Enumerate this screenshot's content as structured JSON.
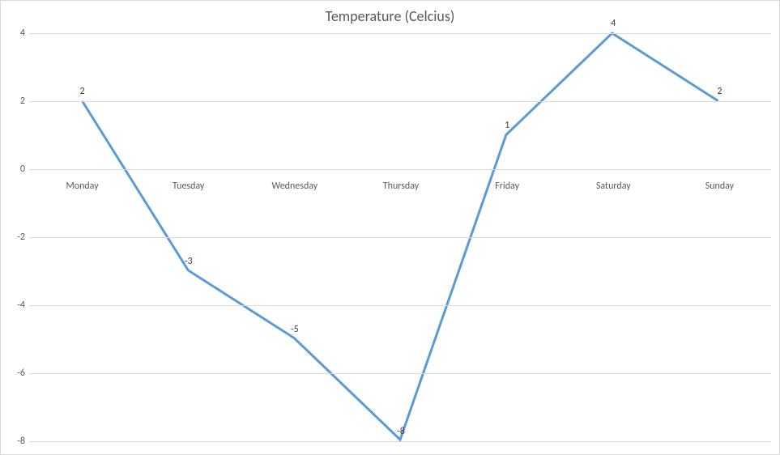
{
  "chart_data": {
    "type": "line",
    "title": "Temperature (Celcius)",
    "categories": [
      "Monday",
      "Tuesday",
      "Wednesday",
      "Thursday",
      "Friday",
      "Saturday",
      "Sunday"
    ],
    "values": [
      2,
      -3,
      -5,
      -8,
      1,
      4,
      2
    ],
    "ylim": [
      -8,
      4
    ],
    "ystep": 2,
    "line_color": "#5b9bd5",
    "grid_color": "#d9d9d9",
    "xlabel": "",
    "ylabel": ""
  }
}
